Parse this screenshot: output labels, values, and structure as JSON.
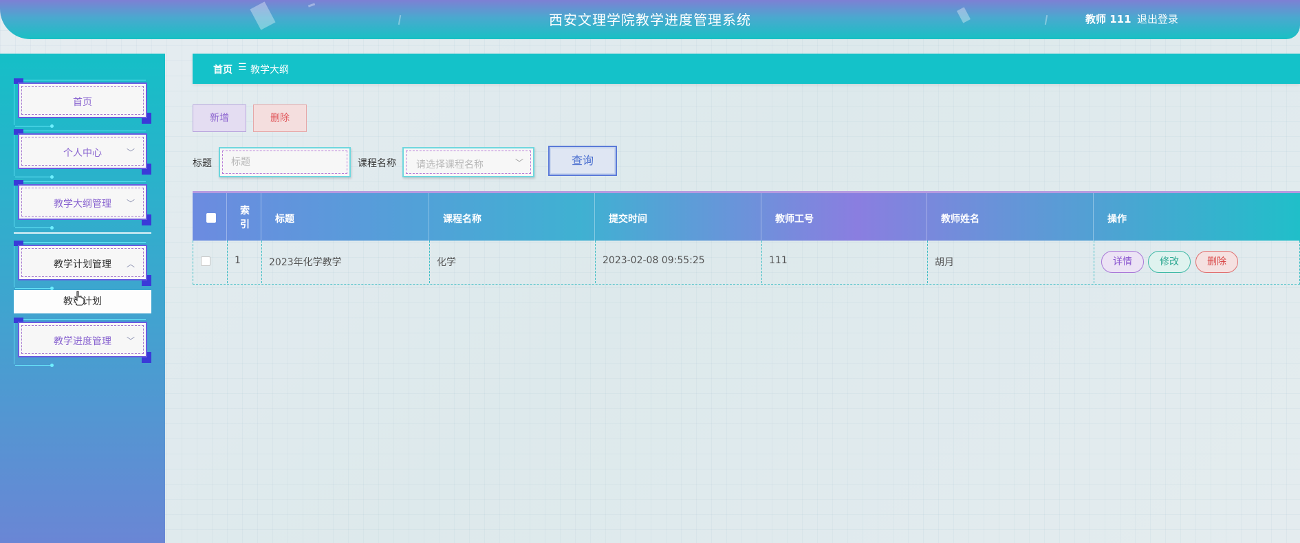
{
  "header": {
    "title": "西安文理学院教学进度管理系统",
    "user": "教师 111",
    "logout": "退出登录"
  },
  "sidebar": {
    "items": [
      {
        "label": "首页"
      },
      {
        "label": "个人中心",
        "chevron": "chevron-down-icon"
      },
      {
        "label": "教学大纲管理",
        "chevron": "chevron-down-icon"
      },
      {
        "label": "教学计划管理",
        "chevron": "chevron-up-icon",
        "open": true
      },
      {
        "label": "教学进度管理",
        "chevron": "chevron-down-icon"
      }
    ],
    "submenu": [
      "教学计划"
    ]
  },
  "breadcrumb": {
    "home": "首页",
    "separator": "☰",
    "current": "教学大纲"
  },
  "toolbar": {
    "add_label": "新增",
    "delete_label": "删除"
  },
  "search": {
    "title_label": "标题",
    "title_placeholder": "标题",
    "course_label": "课程名称",
    "course_placeholder": "请选择课程名称",
    "query_label": "查询"
  },
  "table": {
    "columns": [
      "",
      "索引",
      "标题",
      "课程名称",
      "提交时间",
      "教师工号",
      "教师姓名",
      "操作"
    ],
    "rows": [
      {
        "index": "1",
        "title": "2023年化学教学",
        "course": "化学",
        "submit_time": "2023-02-08 09:55:25",
        "teacher_id": "111",
        "teacher_name": "胡月",
        "actions": [
          "详情",
          "修改",
          "删除"
        ]
      }
    ]
  },
  "colors": {
    "accent": "#14c2c9",
    "purple": "#8b63cf",
    "danger": "#e0575b"
  }
}
